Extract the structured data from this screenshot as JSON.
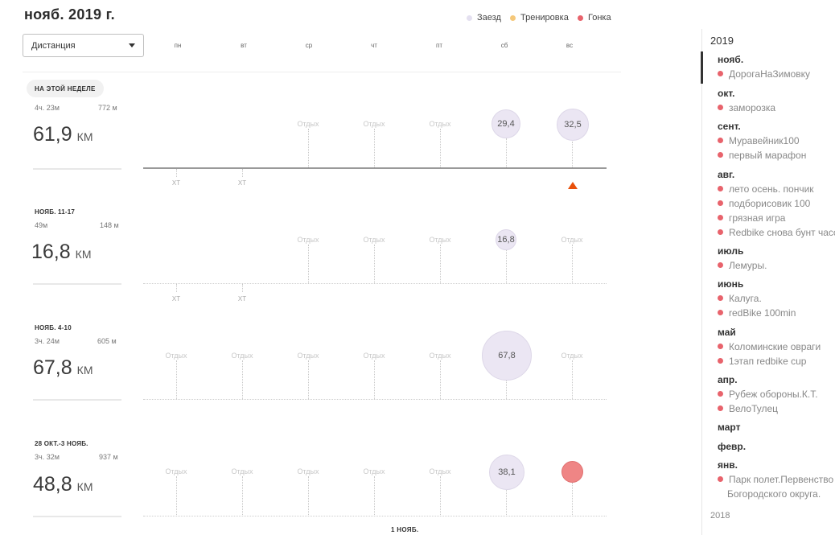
{
  "header": {
    "title": "нояб. 2019 г."
  },
  "legend": [
    {
      "label": "Заезд",
      "color": "#e4e0f0"
    },
    {
      "label": "Тренировка",
      "color": "#f5c87a"
    },
    {
      "label": "Гонка",
      "color": "#e8636c"
    }
  ],
  "filter": {
    "selected": "Дистанция"
  },
  "days": [
    "пн",
    "вт",
    "ср",
    "чт",
    "пт",
    "сб",
    "вс"
  ],
  "weeks": [
    {
      "badge": "НА ЭТОЙ НЕДЕЛЕ",
      "label": "",
      "time": "4ч. 23м",
      "elevation": "772 м",
      "distance": "61,9",
      "unit": "КМ",
      "rest": [
        "",
        "",
        "Отдых",
        "Отдых",
        "Отдых",
        "",
        ""
      ],
      "rides": [
        "",
        "",
        "",
        "",
        "",
        "29,4",
        "32,5"
      ],
      "xt": [
        "ХТ",
        "ХТ"
      ]
    },
    {
      "badge": "",
      "label": "НОЯБ. 11-17",
      "time": "49м",
      "elevation": "148 м",
      "distance": "16,8",
      "unit": "КМ",
      "rest": [
        "",
        "",
        "Отдых",
        "Отдых",
        "Отдых",
        "",
        "Отдых"
      ],
      "rides": [
        "",
        "",
        "",
        "",
        "",
        "16,8",
        ""
      ],
      "xt": [
        "ХТ",
        "ХТ"
      ]
    },
    {
      "badge": "",
      "label": "НОЯБ. 4-10",
      "time": "3ч. 24м",
      "elevation": "605 м",
      "distance": "67,8",
      "unit": "КМ",
      "rest": [
        "Отдых",
        "Отдых",
        "Отдых",
        "Отдых",
        "Отдых",
        "",
        "Отдых"
      ],
      "rides": [
        "",
        "",
        "",
        "",
        "",
        "67,8",
        ""
      ]
    },
    {
      "badge": "",
      "label": "28 ОКТ.-3 НОЯБ.",
      "time": "3ч. 32м",
      "elevation": "937 м",
      "distance": "48,8",
      "unit": "КМ",
      "rest": [
        "Отдых",
        "Отдых",
        "Отдых",
        "Отдых",
        "Отдых",
        "",
        ""
      ],
      "rides": [
        "",
        "",
        "",
        "",
        "",
        "38,1",
        ""
      ]
    }
  ],
  "footer": {
    "marker": "1 НОЯБ."
  },
  "sidebar": {
    "year": "2019",
    "months": [
      {
        "name": "нояб.",
        "events": [
          "ДорогаНаЗимовку"
        ]
      },
      {
        "name": "окт.",
        "events": [
          "заморозка"
        ]
      },
      {
        "name": "сент.",
        "events": [
          "Муравейник100",
          "первый марафон"
        ]
      },
      {
        "name": "авг.",
        "events": [
          "лето осень. пончик",
          "подборисовик 100",
          "грязная игра",
          "Redbike снова бунт часс"
        ]
      },
      {
        "name": "июль",
        "events": [
          "Лемуры."
        ]
      },
      {
        "name": "июнь",
        "events": [
          "Калуга.",
          "redBike 100min"
        ]
      },
      {
        "name": "май",
        "events": [
          "Коломинские овраги",
          "1этап redbike cup"
        ]
      },
      {
        "name": "апр.",
        "events": [
          "Рубеж обороны.К.Т.",
          "ВелоТулец"
        ]
      },
      {
        "name": "март",
        "events": []
      },
      {
        "name": "февр.",
        "events": []
      },
      {
        "name": "янв.",
        "events": [
          "Парк полет.Первенство",
          "Богородского округа."
        ]
      }
    ],
    "prev_year": "2018"
  }
}
